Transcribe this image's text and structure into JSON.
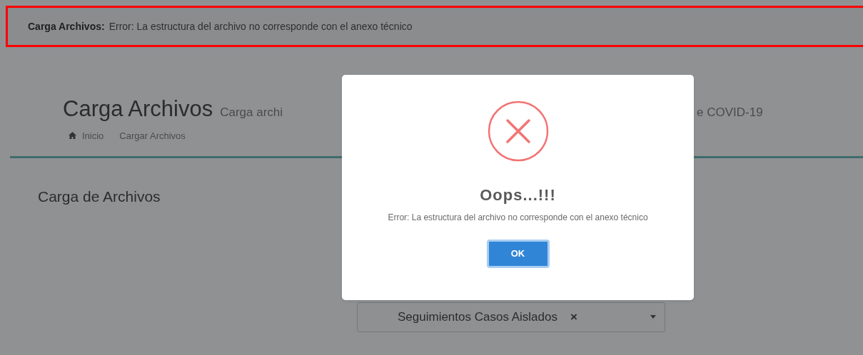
{
  "alert_bar": {
    "label": "Carga Archivos:",
    "message": "Error: La estructura del archivo no corresponde con el anexo técnico"
  },
  "page_header": {
    "title": "Carga Archivos",
    "subtitle_left": "Carga archi",
    "subtitle_right": "e COVID-19",
    "breadcrumb": [
      {
        "label": "Inicio",
        "kind": "home"
      },
      {
        "label": "Cargar Archivos",
        "kind": "page"
      }
    ]
  },
  "panel": {
    "title": "Carga de Archivos",
    "select": {
      "value": "Seguimientos Casos Aislados",
      "clear": "×"
    }
  },
  "dialog": {
    "kind": "error",
    "title": "Oops...!!!",
    "message": "Error: La estructura del archivo no corresponde con el anexo técnico",
    "button": "OK"
  }
}
